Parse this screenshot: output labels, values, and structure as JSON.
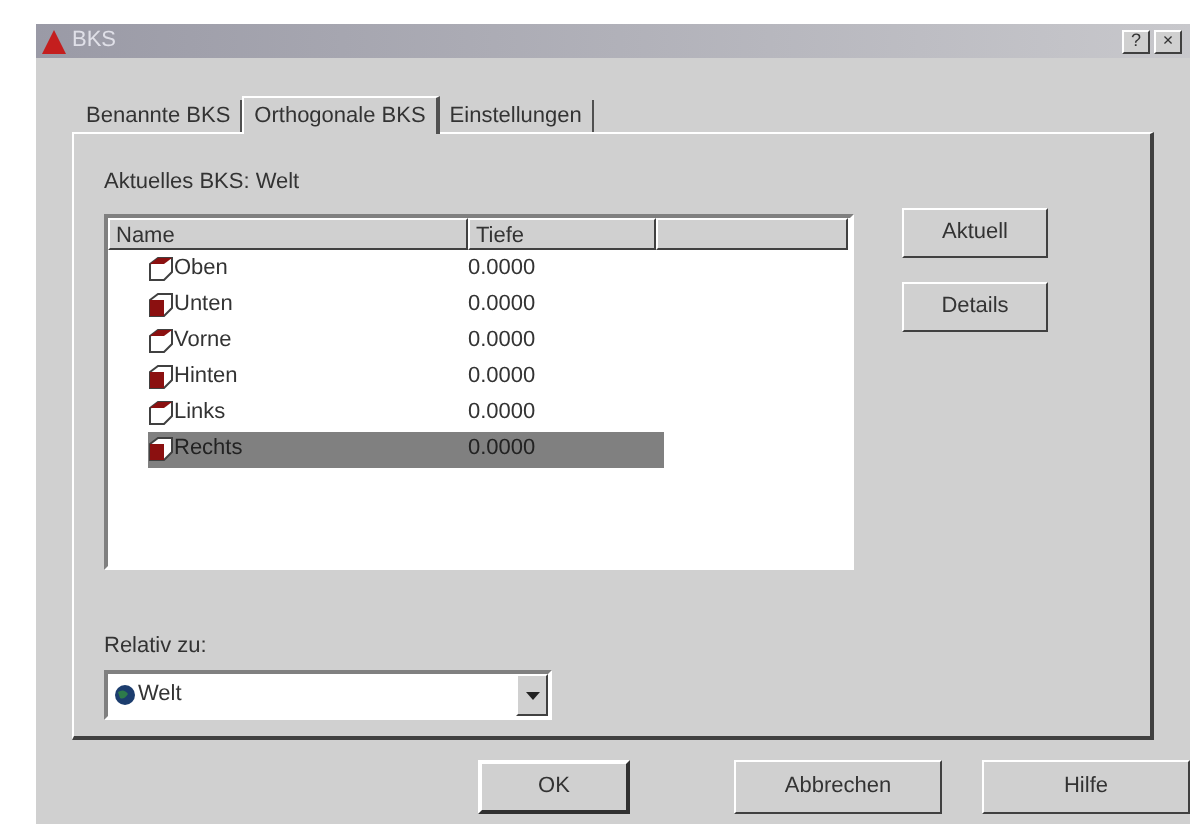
{
  "window": {
    "title": "BKS",
    "help_button": "?",
    "close_button": "×"
  },
  "tabs": [
    {
      "label": "Benannte BKS",
      "selected": false
    },
    {
      "label": "Orthogonale BKS",
      "selected": true
    },
    {
      "label": "Einstellungen",
      "selected": false
    }
  ],
  "current_ucs": "Aktuelles BKS: Welt",
  "table": {
    "columns": [
      "Name",
      "Tiefe"
    ],
    "rows": [
      {
        "name": "Oben",
        "depth": "0.0000",
        "selected": false
      },
      {
        "name": "Unten",
        "depth": "0.0000",
        "selected": false
      },
      {
        "name": "Vorne",
        "depth": "0.0000",
        "selected": false
      },
      {
        "name": "Hinten",
        "depth": "0.0000",
        "selected": false
      },
      {
        "name": "Links",
        "depth": "0.0000",
        "selected": false
      },
      {
        "name": "Rechts",
        "depth": "0.0000",
        "selected": true
      }
    ]
  },
  "side_buttons": [
    "Aktuell",
    "Details"
  ],
  "relative_to": {
    "label": "Relativ zu:",
    "value": "Welt"
  },
  "buttons": [
    "OK",
    "Abbrechen",
    "Hilfe"
  ]
}
